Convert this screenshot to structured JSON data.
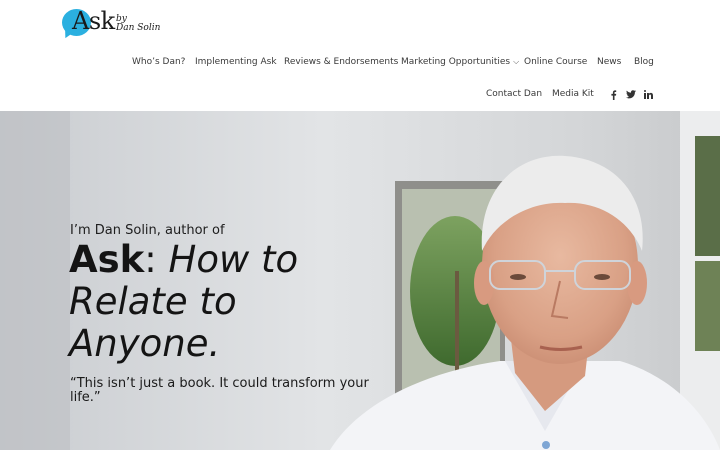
{
  "logo": {
    "main": "Ask",
    "by": "by",
    "name": "Dan Solin"
  },
  "nav": {
    "row1": [
      "Who’s Dan?",
      "Implementing Ask",
      "Reviews & Endorsements",
      "Marketing Opportunities",
      "Online Course",
      "News",
      "Blog"
    ],
    "row2": [
      "Contact Dan",
      "Media Kit"
    ],
    "dropdown_caret": "⌵"
  },
  "social": {
    "icons": [
      "facebook-icon",
      "twitter-icon",
      "linkedin-icon"
    ]
  },
  "hero": {
    "intro": "I’m Dan Solin, author of",
    "title_bold": "Ask",
    "title_colon": ": ",
    "title_italic": "How to Relate to Anyone.",
    "quote": "“This isn’t just a book. It could transform your life.”"
  },
  "colors": {
    "logo_blue": "#2bb0e0",
    "nav_text": "#3a3a3a",
    "hero_bg": "#d9dcdf"
  }
}
